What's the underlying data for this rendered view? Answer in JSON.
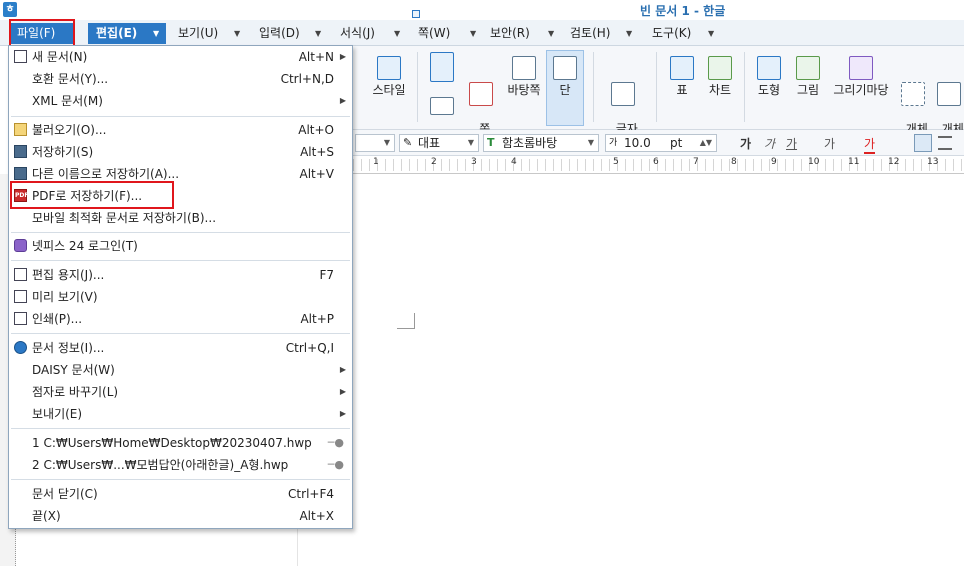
{
  "window": {
    "title": "빈 문서 1 - 한글",
    "app_icon": "hancom-icon"
  },
  "menubar": {
    "items": [
      {
        "label": "파일(F)"
      },
      {
        "label": "편집(E)"
      },
      {
        "label": "보기(U)"
      },
      {
        "label": "입력(D)"
      },
      {
        "label": "서식(J)"
      },
      {
        "label": "쪽(W)"
      },
      {
        "label": "보안(R)"
      },
      {
        "label": "검토(H)"
      },
      {
        "label": "도구(K)"
      }
    ]
  },
  "toolbar": {
    "buttons": [
      {
        "label": "스타일"
      },
      {
        "label": "쪽\n여백"
      },
      {
        "label": "바탕쪽"
      },
      {
        "label": "단"
      },
      {
        "label": "글자\n바꾸기"
      },
      {
        "label": "표"
      },
      {
        "label": "차트"
      },
      {
        "label": "도형"
      },
      {
        "label": "그림"
      },
      {
        "label": "그리기마당"
      },
      {
        "label": "개체\n선택"
      },
      {
        "label": "개체\n보호"
      }
    ]
  },
  "formatbar": {
    "style_select": "대표",
    "font_select": "함초롬바탕",
    "size_value": "10.0",
    "size_unit": "pt",
    "format_buttons": [
      "가",
      "가",
      "가",
      "가",
      "가"
    ]
  },
  "ruler": {
    "numbers": [
      "1",
      "2",
      "3",
      "4",
      "5",
      "6",
      "7",
      "8",
      "9",
      "10",
      "11",
      "12",
      "13"
    ]
  },
  "file_menu": {
    "items": [
      {
        "label": "새 문서(N)",
        "key": "Alt+N",
        "submenu": true,
        "icon": "new-doc-icon"
      },
      {
        "label": "호환 문서(Y)...",
        "key": "Ctrl+N,D"
      },
      {
        "label": "XML 문서(M)",
        "submenu": true
      },
      {
        "label": "불러오기(O)...",
        "key": "Alt+O",
        "icon": "folder-open-icon"
      },
      {
        "label": "저장하기(S)",
        "key": "Alt+S",
        "icon": "save-icon"
      },
      {
        "label": "다른 이름으로 저장하기(A)...",
        "key": "Alt+V",
        "icon": "save-as-icon"
      },
      {
        "label": "PDF로 저장하기(F)...",
        "icon": "pdf-icon"
      },
      {
        "label": "모바일 최적화 문서로 저장하기(B)..."
      },
      {
        "label": "넷피스 24 로그인(T)",
        "icon": "netffice-icon"
      },
      {
        "label": "편집 용지(J)...",
        "key": "F7",
        "icon": "page-setup-icon"
      },
      {
        "label": "미리 보기(V)",
        "icon": "preview-icon"
      },
      {
        "label": "인쇄(P)...",
        "key": "Alt+P",
        "icon": "print-icon"
      },
      {
        "label": "문서 정보(I)...",
        "key": "Ctrl+Q,I",
        "icon": "info-icon"
      },
      {
        "label": "DAISY 문서(W)",
        "submenu": true
      },
      {
        "label": "점자로 바꾸기(L)",
        "submenu": true
      },
      {
        "label": "보내기(E)",
        "submenu": true
      },
      {
        "label": "1 C:₩Users₩Home₩Desktop₩20230407.hwp",
        "pin": true
      },
      {
        "label": "2 C:₩Users₩...₩모범답안(아래한글)_A형.hwp",
        "pin": true
      },
      {
        "label": "문서 닫기(C)",
        "key": "Ctrl+F4"
      },
      {
        "label": "끝(X)",
        "key": "Alt+X"
      }
    ]
  },
  "colors": {
    "accent": "#2b78c5",
    "highlight_box": "#e0161c",
    "menubar_bg": "#eef3f8"
  }
}
